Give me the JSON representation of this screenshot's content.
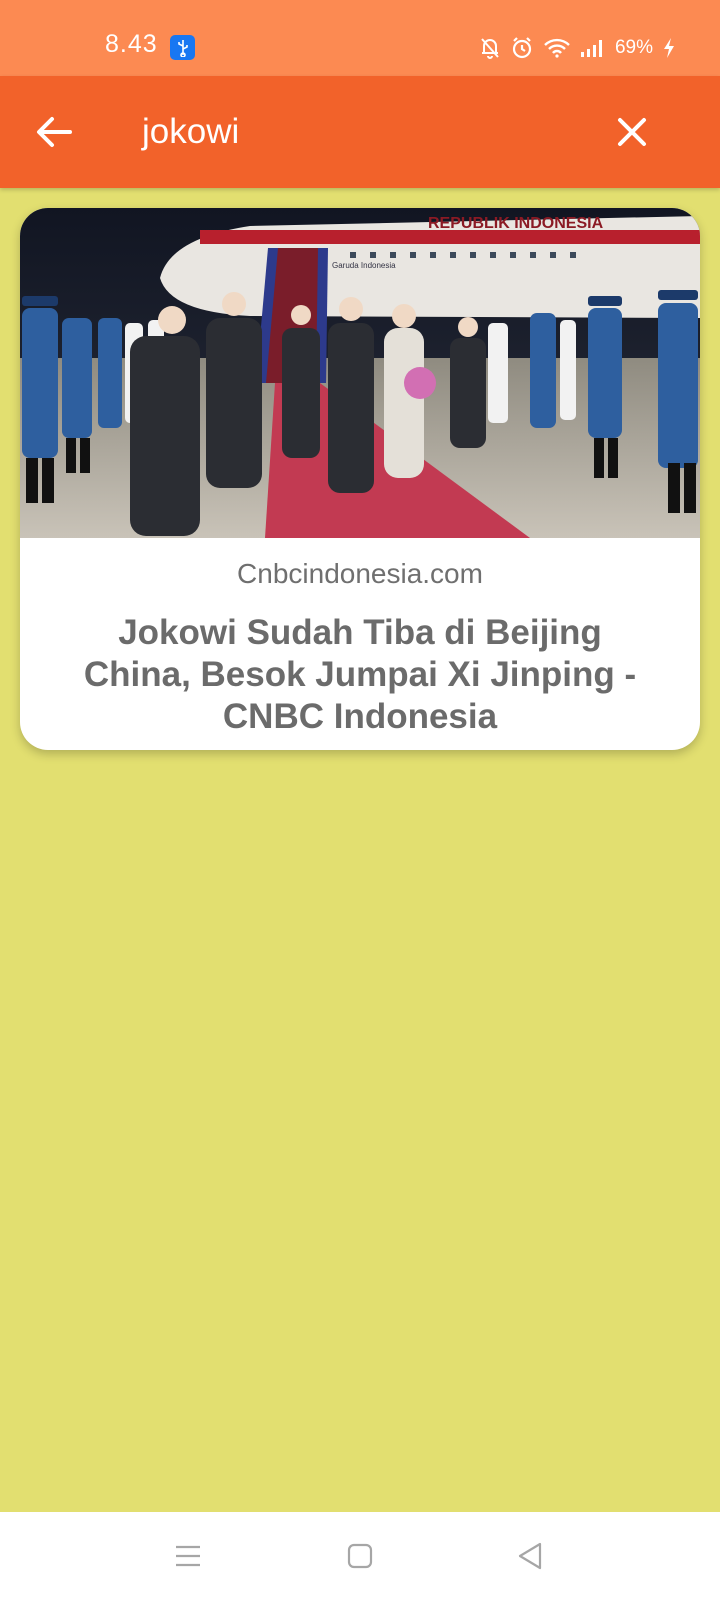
{
  "status_bar": {
    "time": "8.43",
    "battery": "69%",
    "icons": [
      "usb-icon",
      "bell-off-icon",
      "alarm-icon",
      "wifi-icon",
      "signal-icon",
      "charging-icon"
    ]
  },
  "app_bar": {
    "back_icon": "arrow-left-icon",
    "query": "jokowi",
    "clear_icon": "close-icon"
  },
  "result": {
    "image_description": "photo-airport-arrival",
    "plane_livery": "REPUBLIK INDONESIA",
    "plane_sublivery": "Garuda Indonesia",
    "source": "Cnbcindonesia.com",
    "title": "Jokowi Sudah Tiba di Beijing China, Besok Jumpai Xi Jinping - CNBC Indonesia"
  },
  "nav_bar": {
    "icons": [
      "menu-icon",
      "home-icon",
      "back-triangle-icon"
    ]
  },
  "colors": {
    "status_bar": "#fc8a52",
    "app_bar": "#f2622a",
    "background": "#e2df70",
    "card": "#ffffff"
  }
}
